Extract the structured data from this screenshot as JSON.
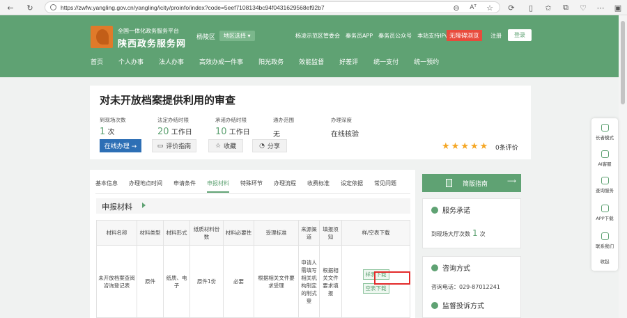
{
  "browser": {
    "url": "https://zwfw.yangling.gov.cn/yangling/icity/proinfo/index?code=5eef7108134bc94f0431629568ef92b7",
    "reader_label": "Aᵀ"
  },
  "header": {
    "site_subtitle": "全国一体化政务服务平台",
    "site_title": "陕西政务服务网",
    "district": "杨陵区",
    "district_select": "地区选择 ▾",
    "top_links": [
      "杨凌示范区管委会",
      "秦务员APP",
      "秦务员公众号",
      "本站支持IPv6"
    ],
    "barrier_free": "无障碍浏览",
    "register": "注册",
    "login": "登录",
    "nav": [
      "首页",
      "个人办事",
      "法人办事",
      "高效办成一件事",
      "阳光政务",
      "效能监督",
      "好差评",
      "统一支付",
      "统一预约"
    ]
  },
  "item": {
    "title": "对未开放档案提供利用的审查",
    "meta": [
      {
        "label": "到现场次数",
        "value": "1",
        "unit": "次"
      },
      {
        "label": "法定办结时限",
        "value": "20",
        "unit": "工作日"
      },
      {
        "label": "承诺办结时限",
        "value": "10",
        "unit": "工作日"
      },
      {
        "label": "通办范围",
        "value": "",
        "unit": "无"
      },
      {
        "label": "办理深度",
        "value": "",
        "unit": "在线核验"
      }
    ],
    "btn_online": "在线办理 →",
    "btn_guide": "评价指南",
    "btn_collect": "收藏",
    "btn_share": "分享",
    "rating": 5,
    "eval_count": "0条评价"
  },
  "tabs": [
    "基本信息",
    "办理地点时间",
    "申请条件",
    "申报材料",
    "特殊环节",
    "办理流程",
    "收费标准",
    "设定依据",
    "常见问题"
  ],
  "active_tab": "申报材料",
  "materials": {
    "section_title": "申报材料",
    "headers": [
      "材料名称",
      "材料类型",
      "材料形式",
      "纸质材料份数",
      "材料必要性",
      "受理标准",
      "来源渠道",
      "填报须知",
      "样/空表下载"
    ],
    "row": {
      "name": "未开放档案查阅咨询登记表",
      "type": "原件",
      "form": "纸质、电子",
      "copies": "原件1份",
      "necessity": "必要",
      "standard": "根据相关文件要求受理",
      "source": "申请人需填写相关机构制定的制式登",
      "notes": "根据相关文件要求填报",
      "sample_download": "样表下载",
      "blank_download": "空表下载"
    }
  },
  "sidebar": {
    "simple_guide": "简版指南",
    "service_title": "服务承诺",
    "visit_label": "到现场大厅次数",
    "visit_value": "1",
    "visit_unit": "次",
    "consult_title": "咨询方式",
    "consult_phone": "咨询电话：029-87012241",
    "complaint_title": "监督投诉方式"
  },
  "float_bar": [
    "长者模式",
    "AI客服",
    "查询服务",
    "APP下载",
    "联系我们",
    "收起"
  ]
}
